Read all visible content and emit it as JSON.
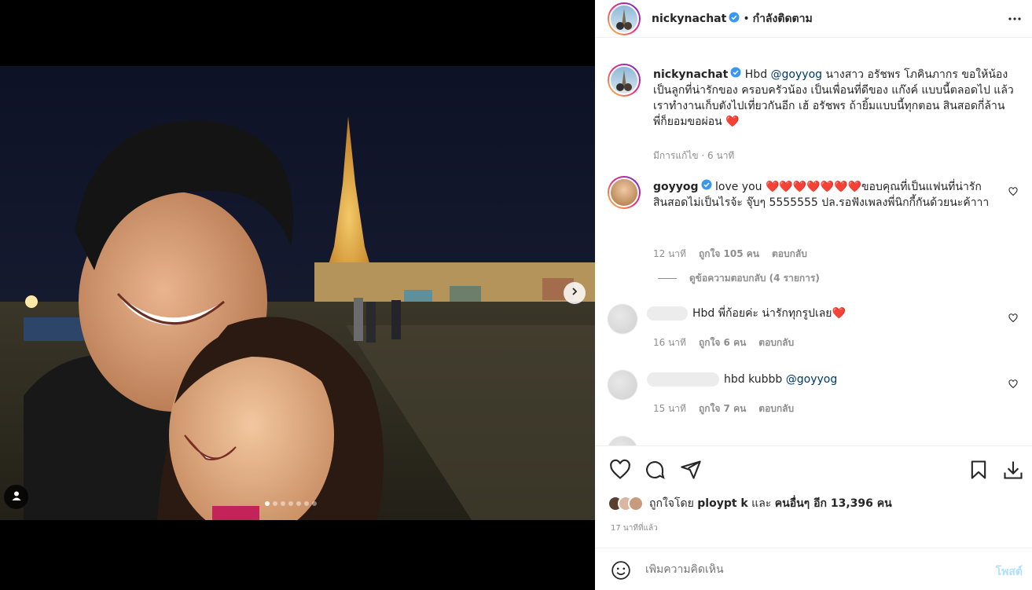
{
  "post": {
    "username": "nickynachat",
    "separator": "•",
    "follow_status": "กำลังติดตาม",
    "caption_username": "nickynachat",
    "caption_text": "Hbd ",
    "caption_mention": "@goyyog",
    "caption_rest": " นางสาว อรัชพร โภคินภากร ขอให้น้องเป็นลูกที่น่ารักของ ครอบครัวน้อง เป็นเพื่อนที่ดีของ แก๊งค์ แบบนี้ตลอดไป แล้วเราทำงานเก็บตังไปเที่ยวกันอีก เฮ้ อรัชพร ถ้ายิ้มแบบนี้ทุกตอน สินสอดกี่ล้าน พี่ก็ยอมขอผ่อน ❤️",
    "caption_meta": "มีการแก้ไข · 6 นาที",
    "carousel_total": 7,
    "carousel_active": 0
  },
  "comments": [
    {
      "username": "goyyog",
      "verified": true,
      "text": "love you ❤️❤️❤️❤️❤️❤️❤️ขอบคุณที่เป็นแฟนที่น่ารัก สินสอดไม่เป็นไรจ้ะ จุ๊บๆ 5555555 ปล.รอฟังเพลงพี่นิกกี้กันด้วยนะค้าาา",
      "time": "12 นาที",
      "likes": "ถูกใจ 105 คน",
      "reply": "ตอบกลับ",
      "view_replies": "ดูข้อความตอบกลับ (4 รายการ)"
    },
    {
      "text": "Hbd พี่ก้อยค่ะ น่ารักทุกรูปเลย❤️",
      "time": "16 นาที",
      "likes": "ถูกใจ 6 คน",
      "reply": "ตอบกลับ"
    },
    {
      "text": "hbd kubbb ",
      "mention": "@goyyog",
      "time": "15 นาที",
      "likes": "ถูกใจ 7 คน",
      "reply": "ตอบกลับ"
    }
  ],
  "likes_summary": {
    "prefix": "ถูกใจโดย ",
    "liker": "ploypt k",
    "middle": " และ ",
    "others": "คนอื่นๆ อีก 13,396 คน"
  },
  "posted_ago": "17 นาทีที่แล้ว",
  "add_comment": {
    "placeholder": "เพิ่มความคิดเห็น",
    "post_label": "โพสต์"
  },
  "icons": {
    "verified": "verified-badge-icon",
    "more": "more-options-icon",
    "like": "heart-icon",
    "comment": "comment-icon",
    "share": "share-icon",
    "save": "bookmark-icon",
    "download": "download-icon",
    "emoji": "emoji-icon",
    "next": "chevron-right-icon",
    "tag": "user-tag-icon"
  },
  "colors": {
    "verified": "#3897f0",
    "mention": "#00376b",
    "post_button": "#b2dffc"
  }
}
